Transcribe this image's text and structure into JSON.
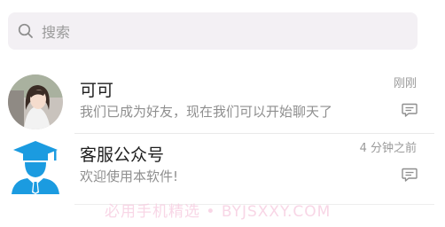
{
  "search": {
    "placeholder": "搜索",
    "icon": "search-icon"
  },
  "conversations": [
    {
      "name": "可可",
      "message": "我们已成为好友，现在我们可以开始聊天了",
      "time": "刚刚",
      "avatar": "user-photo-avatar"
    },
    {
      "name": "客服公众号",
      "message": "欢迎使用本软件!",
      "time": "4 分钟之前",
      "avatar": "service-agent-avatar",
      "avatar_color": "#1b9be0"
    }
  ],
  "watermark": "必用手机精选 • BYJSXXY.COM",
  "colors": {
    "search_bg": "#f3f0f4",
    "text_secondary": "#8f8f8f",
    "accent_blue": "#1b9be0"
  }
}
